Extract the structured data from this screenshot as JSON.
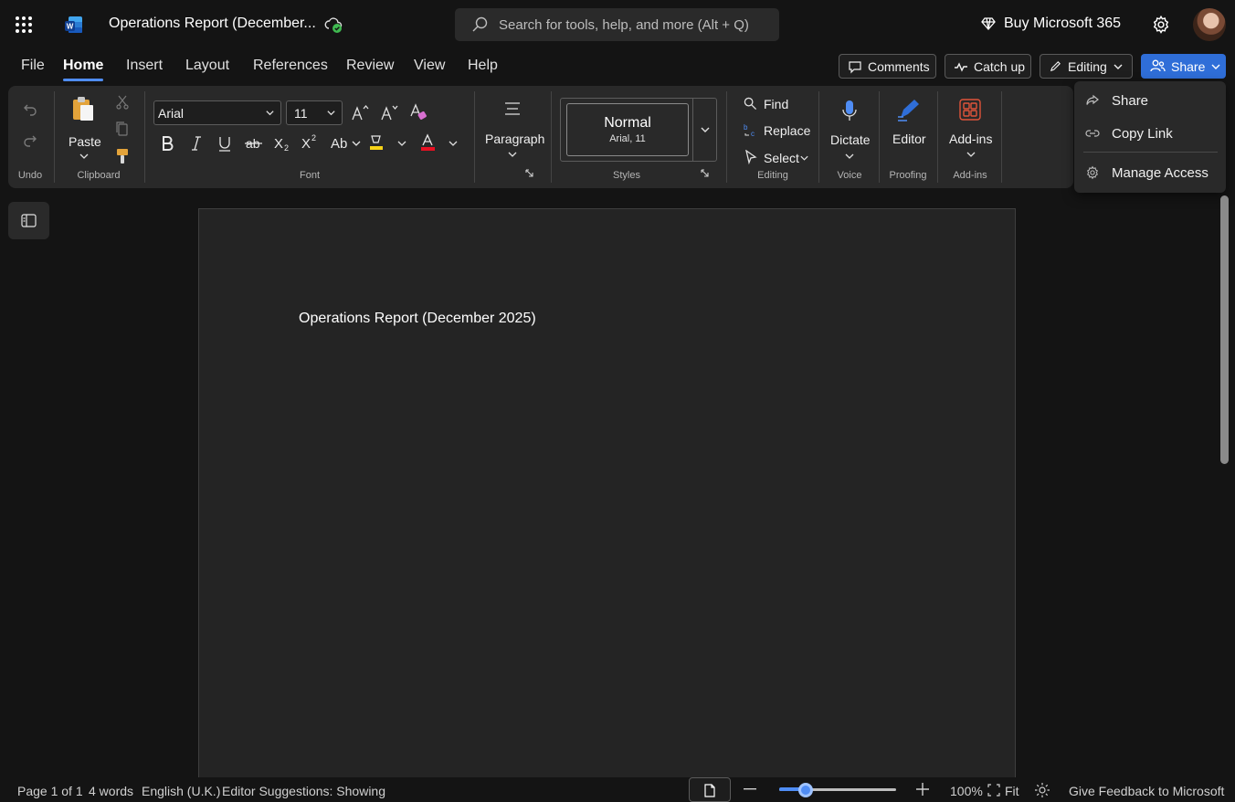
{
  "titlebar": {
    "doc_title": "Operations Report (December...",
    "search_placeholder": "Search for tools, help, and more (Alt + Q)",
    "buy_label": "Buy Microsoft 365"
  },
  "menu": {
    "tabs": [
      "File",
      "Home",
      "Insert",
      "Layout",
      "References",
      "Review",
      "View",
      "Help"
    ],
    "active_tab": "Home",
    "comments_label": "Comments",
    "catchup_label": "Catch up",
    "editing_label": "Editing",
    "share_label": "Share"
  },
  "ribbon": {
    "undo_group": "Undo",
    "paste_label": "Paste",
    "clipboard_group": "Clipboard",
    "font_name": "Arial",
    "font_size": "11",
    "font_group": "Font",
    "paragraph_label": "Paragraph",
    "style_name": "Normal",
    "style_detail": "Arial, 11",
    "styles_group": "Styles",
    "find_label": "Find",
    "replace_label": "Replace",
    "select_label": "Select",
    "editing_group": "Editing",
    "dictate_label": "Dictate",
    "voice_group": "Voice",
    "editor_label": "Editor",
    "proofing_group": "Proofing",
    "addins_label": "Add-ins",
    "addins_group": "Add-ins",
    "font_color": "#e81123",
    "highlight_color": "#f7d417"
  },
  "share_menu": {
    "items": [
      "Share",
      "Copy Link",
      "Manage Access"
    ]
  },
  "document": {
    "heading": "Operations Report (December 2025)"
  },
  "statusbar": {
    "page": "Page 1 of 1",
    "words": "4 words",
    "language": "English (U.K.)",
    "editor": "Editor Suggestions: Showing",
    "zoom": "100%",
    "fit": "Fit",
    "feedback": "Give Feedback to Microsoft",
    "zoom_slider_fraction": 0.23
  },
  "colors": {
    "accent": "#2f6ed8",
    "background": "#141414",
    "page": "#242424"
  }
}
